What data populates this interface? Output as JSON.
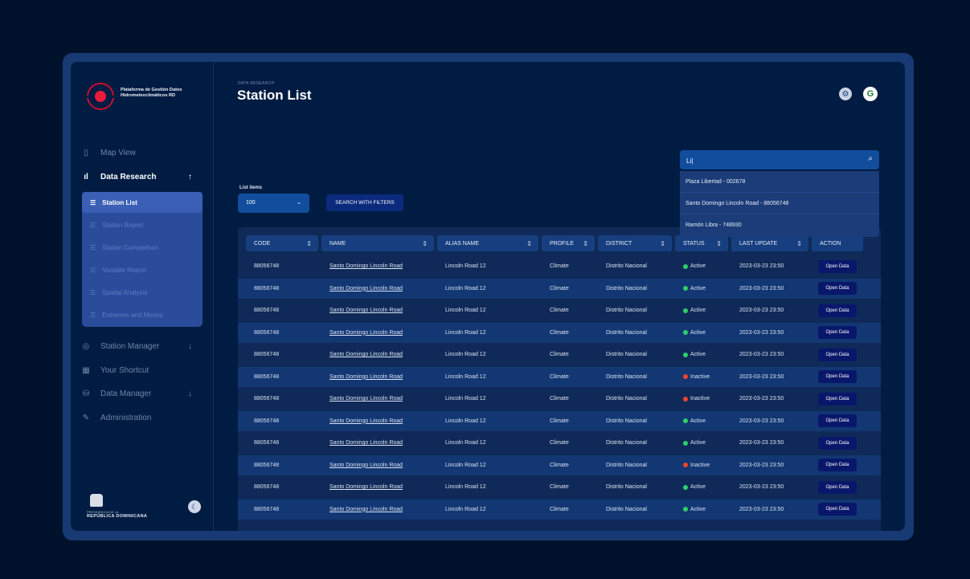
{
  "app": {
    "name": "Plataforma de Gestión Datos Hidrometeoclimáticos RD"
  },
  "header": {
    "eyebrow": "DATA RESEARCH",
    "title": "Station List"
  },
  "sidebar": {
    "items": [
      {
        "label": "Map View",
        "icon": "map-icon",
        "active": false
      },
      {
        "label": "Data Research",
        "icon": "bar-chart-icon",
        "active": true,
        "expanded": true
      },
      {
        "label": "Station Manager",
        "icon": "location-icon",
        "active": false
      },
      {
        "label": "Your Shortcut",
        "icon": "grid-icon",
        "active": false
      },
      {
        "label": "Data Manager",
        "icon": "database-icon",
        "active": false
      },
      {
        "label": "Administration",
        "icon": "wrench-icon",
        "active": false
      }
    ],
    "subitems": [
      {
        "label": "Station List",
        "active": true
      },
      {
        "label": "Station Report",
        "active": false
      },
      {
        "label": "Station Comparison",
        "active": false
      },
      {
        "label": "Variable Report",
        "active": false
      },
      {
        "label": "Spatial Analysis",
        "active": false
      },
      {
        "label": "Extremes and Means",
        "active": false
      }
    ],
    "footer": {
      "line1": "PRESIDENCIA DE LA",
      "line2": "REPÚBLICA DOMINICANA"
    }
  },
  "search": {
    "value": "Li|",
    "suggestions": [
      "Plaza Libertad - 002678",
      "Santo Domingo Lincoln Road - 88056748",
      "Ramón Libra - 748930"
    ]
  },
  "controls": {
    "list_label": "List items",
    "list_value": "100",
    "filter_button": "SEARCH WITH FILTERS"
  },
  "table": {
    "columns": [
      "CODE",
      "NAME",
      "ALIAS NAME",
      "PROFILE",
      "DISTRICT",
      "STATUS",
      "LAST UPDATE",
      "ACTION"
    ],
    "action_label": "Open Data",
    "status_colors": {
      "Active": "#2ecf6b",
      "Inactive": "#f0452e"
    },
    "rows": [
      {
        "code": "88056748",
        "name": "Santo Domingo Lincoln Road",
        "alias": "Lincoln Road 12",
        "profile": "Climate",
        "district": "Distrito Nacional",
        "status": "Active",
        "updated": "2023-03-23 23:50"
      },
      {
        "code": "88056748",
        "name": "Santo Domingo Lincoln Road",
        "alias": "Lincoln Road 12",
        "profile": "Climate",
        "district": "Distrito Nacional",
        "status": "Active",
        "updated": "2023-03-23 23:50"
      },
      {
        "code": "88056748",
        "name": "Santo Domingo Lincoln Road",
        "alias": "Lincoln Road 12",
        "profile": "Climate",
        "district": "Distrito Nacional",
        "status": "Active",
        "updated": "2023-03-23 23:50"
      },
      {
        "code": "88056748",
        "name": "Santo Domingo Lincoln Road",
        "alias": "Lincoln Road 12",
        "profile": "Climate",
        "district": "Distrito Nacional",
        "status": "Active",
        "updated": "2023-03-23 23:50"
      },
      {
        "code": "88056748",
        "name": "Santo Domingo Lincoln Road",
        "alias": "Lincoln Road 12",
        "profile": "Climate",
        "district": "Distrito Nacional",
        "status": "Active",
        "updated": "2023-03-23 23:50"
      },
      {
        "code": "88056748",
        "name": "Santo Domingo Lincoln Road",
        "alias": "Lincoln Road 12",
        "profile": "Climate",
        "district": "Distrito Nacional",
        "status": "Inactive",
        "updated": "2023-03-23 23:50"
      },
      {
        "code": "88056748",
        "name": "Santo Domingo Lincoln Road",
        "alias": "Lincoln Road 12",
        "profile": "Climate",
        "district": "Distrito Nacional",
        "status": "Inactive",
        "updated": "2023-03-23 23:50"
      },
      {
        "code": "88056748",
        "name": "Santo Domingo Lincoln Road",
        "alias": "Lincoln Road 12",
        "profile": "Climate",
        "district": "Distrito Nacional",
        "status": "Active",
        "updated": "2023-03-23 23:50"
      },
      {
        "code": "88056748",
        "name": "Santo Domingo Lincoln Road",
        "alias": "Lincoln Road 12",
        "profile": "Climate",
        "district": "Distrito Nacional",
        "status": "Active",
        "updated": "2023-03-23 23:50"
      },
      {
        "code": "88056748",
        "name": "Santo Domingo Lincoln Road",
        "alias": "Lincoln Road 12",
        "profile": "Climate",
        "district": "Distrito Nacional",
        "status": "Inactive",
        "updated": "2023-03-23 23:50"
      },
      {
        "code": "88056748",
        "name": "Santo Domingo Lincoln Road",
        "alias": "Lincoln Road 12",
        "profile": "Climate",
        "district": "Distrito Nacional",
        "status": "Active",
        "updated": "2023-03-23 23:50"
      },
      {
        "code": "88056748",
        "name": "Santo Domingo Lincoln Road",
        "alias": "Lincoln Road 12",
        "profile": "Climate",
        "district": "Distrito Nacional",
        "status": "Active",
        "updated": "2023-03-23 23:50"
      }
    ]
  }
}
